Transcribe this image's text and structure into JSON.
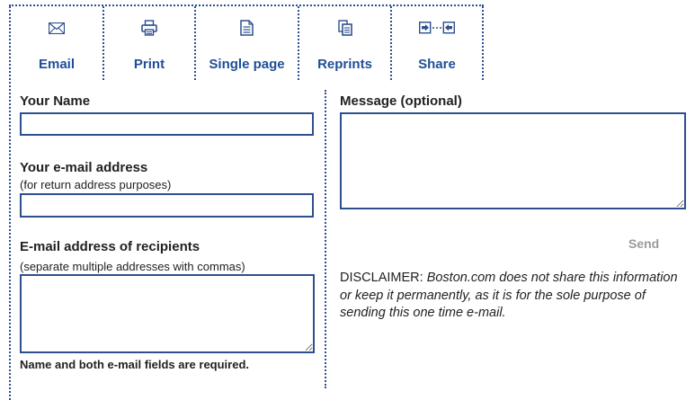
{
  "toolbar": {
    "items": [
      {
        "label": "Email",
        "icon": "envelope-icon"
      },
      {
        "label": "Print",
        "icon": "printer-icon"
      },
      {
        "label": "Single page",
        "icon": "document-icon"
      },
      {
        "label": "Reprints",
        "icon": "copies-icon"
      },
      {
        "label": "Share",
        "icon": "share-arrows-icon"
      }
    ]
  },
  "form": {
    "your_name_label": "Your Name",
    "your_name_value": "",
    "your_email_label": "Your e-mail address",
    "your_email_hint": "(for return address purposes)",
    "your_email_value": "",
    "recipients_label": "E-mail address of recipients",
    "recipients_hint": "(separate multiple addresses with commas)",
    "recipients_value": "",
    "required_note": "Name and both e-mail fields are required.",
    "message_label": "Message (optional)",
    "message_value": "",
    "send_label": "Send",
    "disclaimer_prefix": "DISCLAIMER: ",
    "disclaimer_text": "Boston.com does not share this information or keep it permanently, as it is for the sole purpose of sending this one time e-mail."
  },
  "colors": {
    "accent": "#2d4f8f",
    "link": "#1f4e98",
    "send_disabled": "#9a9a9a"
  }
}
